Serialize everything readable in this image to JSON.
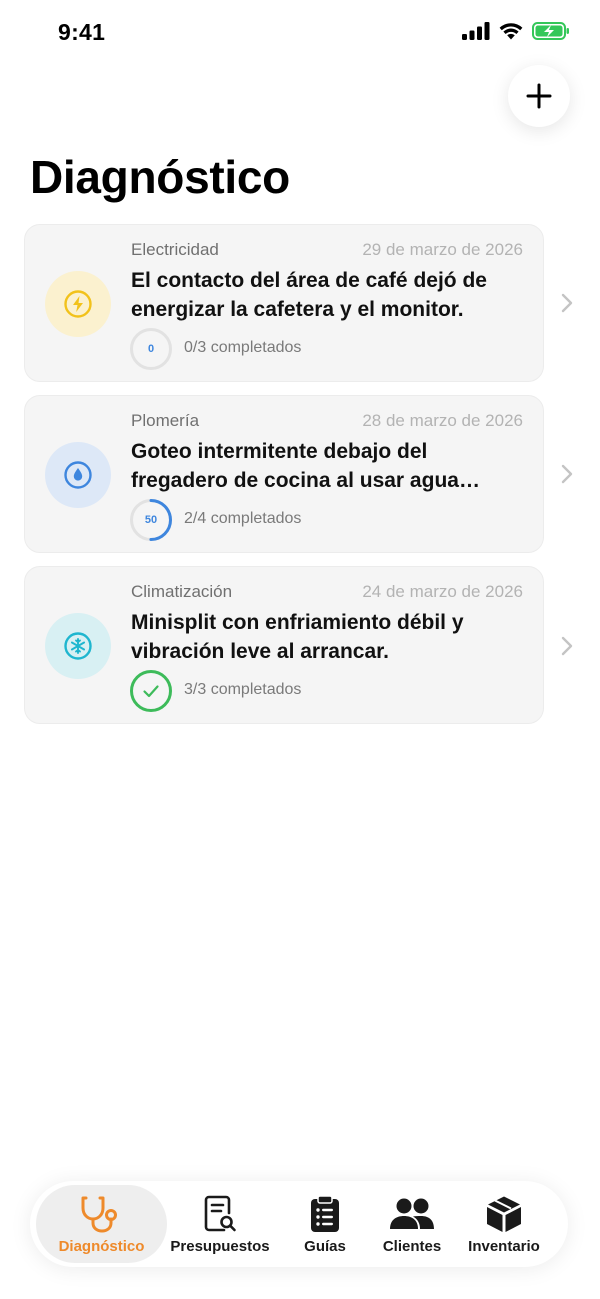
{
  "status_bar": {
    "time": "9:41"
  },
  "header": {
    "title": "Diagnóstico",
    "add_icon": "plus-icon"
  },
  "diagnostics": [
    {
      "category": "Electricidad",
      "date": "29 de marzo de 2026",
      "title": "El contacto del área de café dejó de energizar la cafetera y el monitor.",
      "icon": "lightning-bolt-icon",
      "accent": "#f2c21b",
      "icon_bg": "#fbf1cf",
      "progress_percent": 0,
      "progress_label": "0",
      "progress_text": "0/3 completados"
    },
    {
      "category": "Plomería",
      "date": "28 de marzo de 2026",
      "title": "Goteo intermitente debajo del fregadero de cocina al usar agua caliente.",
      "icon": "water-drop-icon",
      "accent": "#3e86de",
      "icon_bg": "#dde8f7",
      "progress_percent": 50,
      "progress_label": "50",
      "progress_text": "2/4 completados"
    },
    {
      "category": "Climatización",
      "date": "24 de marzo de 2026",
      "title": "Minisplit con enfriamiento débil y vibración leve al arrancar.",
      "icon": "snowflake-icon",
      "accent": "#1fb6cf",
      "icon_bg": "#d8f0f3",
      "progress_percent": 100,
      "progress_label": "",
      "progress_text": "3/3 completados"
    }
  ],
  "tabs": [
    {
      "label": "Diagnóstico",
      "icon": "stethoscope-icon",
      "active": true
    },
    {
      "label": "Presupuestos",
      "icon": "document-search-icon",
      "active": false
    },
    {
      "label": "Guías",
      "icon": "clipboard-list-icon",
      "active": false
    },
    {
      "label": "Clientes",
      "icon": "people-icon",
      "active": false
    },
    {
      "label": "Inventario",
      "icon": "box-icon",
      "active": false
    }
  ],
  "colors": {
    "accent_orange": "#ee8a2b",
    "progress_blue": "#3e86de",
    "complete_green": "#3dbb5a"
  }
}
